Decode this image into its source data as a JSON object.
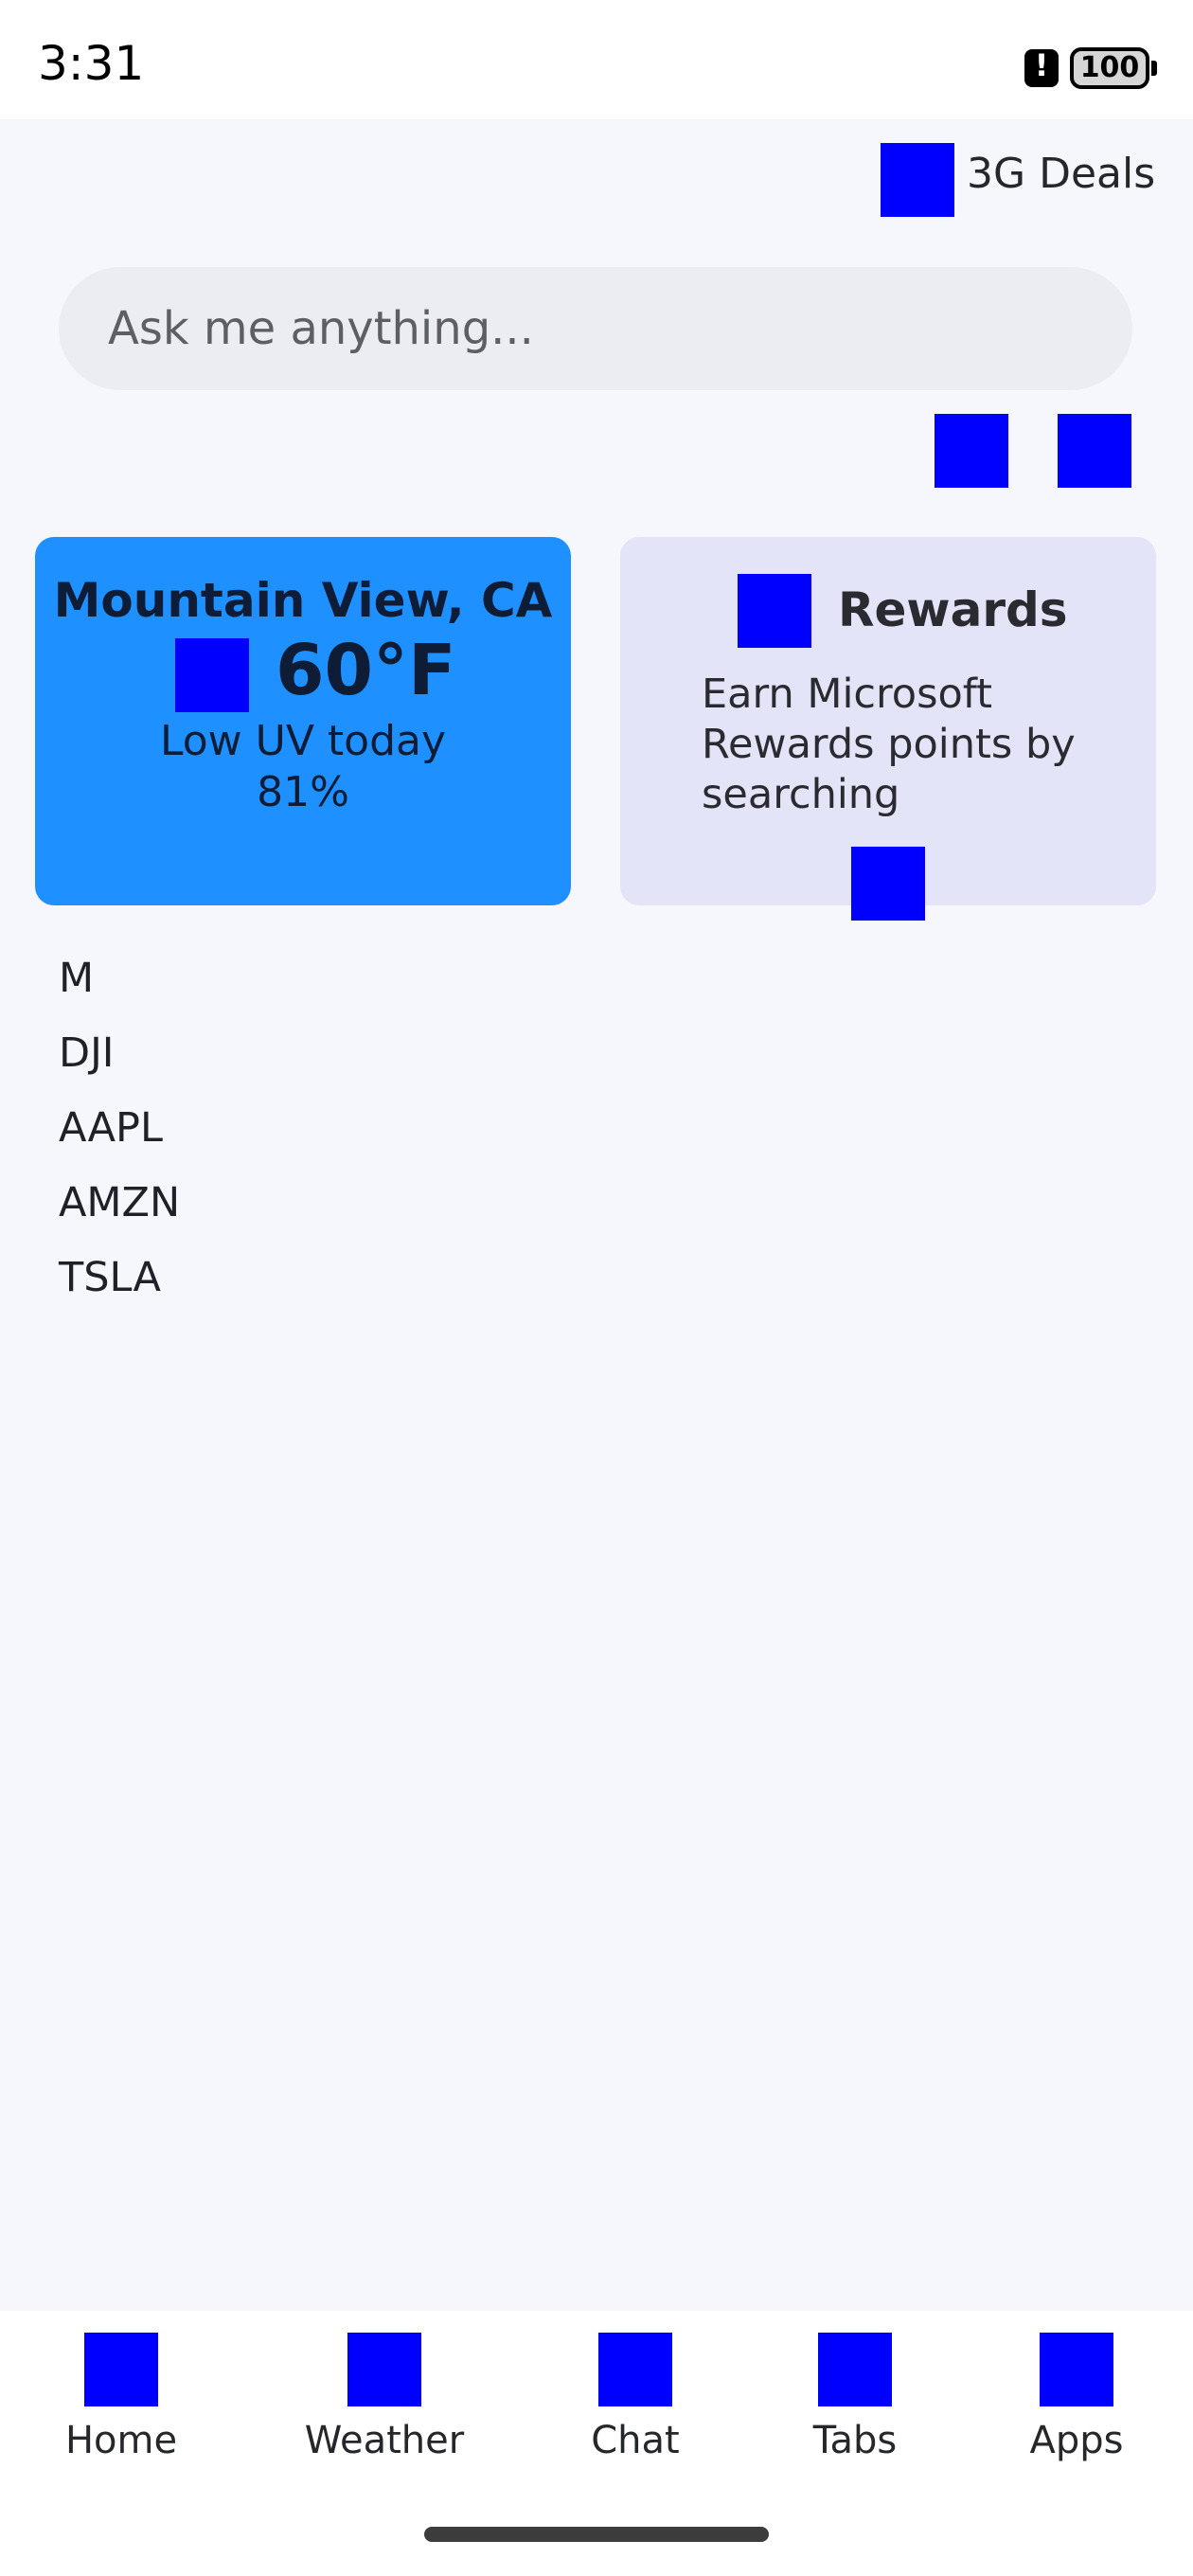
{
  "status_bar": {
    "time": "3:31",
    "battery": "100",
    "alert_icon": "alert-icon"
  },
  "header": {
    "deals_label": "3G Deals",
    "deals_icon": "deals-icon"
  },
  "search": {
    "placeholder": "Ask me anything...",
    "value": ""
  },
  "toolbar": {
    "icons": [
      "visual-search-icon",
      "voice-search-icon"
    ]
  },
  "weather_card": {
    "city": "Mountain View, CA",
    "temperature": "60°F",
    "uv": "Low UV today",
    "humidity": "81%",
    "icon": "weather-condition-icon",
    "color": "#1E90FF"
  },
  "rewards_card": {
    "title": "Rewards",
    "description": "Earn Microsoft Rewards points by searching",
    "icon": "rewards-icon",
    "action_icon": "rewards-action-icon",
    "color": "#E4E4F8"
  },
  "tickers": [
    "M",
    "DJI",
    "AAPL",
    "AMZN",
    "TSLA"
  ],
  "bottom_nav": {
    "items": [
      {
        "label": "Home",
        "icon": "home-icon"
      },
      {
        "label": "Weather",
        "icon": "weather-icon"
      },
      {
        "label": "Chat",
        "icon": "chat-icon"
      },
      {
        "label": "Tabs",
        "icon": "tabs-icon"
      },
      {
        "label": "Apps",
        "icon": "apps-icon"
      }
    ]
  },
  "colors": {
    "icon_placeholder": "#0000FF",
    "background": "#F6F7FC"
  }
}
